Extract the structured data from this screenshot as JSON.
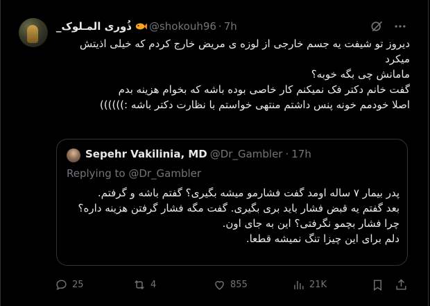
{
  "tweet": {
    "author": {
      "display_name": "ذُوری المـلوک_",
      "handle": "@shokouh96",
      "separator": "·",
      "time": "7h"
    },
    "text_lines": [
      "دیروز تو شیفت یه جسم خارجی از لوزه ی مریض خارج کردم که خیلی اذیتش میکرد",
      "مامانش چی بگه خوبه؟",
      "گفت خانم دکتر فک نمیکنم کار خاصی بوده باشه که بخوام هزینه بدم",
      "اصلا خودمم خونه پنس داشتم منتهی خواستم با نظارت دکتر باشه :))))))"
    ],
    "quote": {
      "display_name": "Sepehr Vakilinia, MD",
      "handle": "@Dr_Gambler",
      "separator": "·",
      "time": "17h",
      "replying_to": "Replying to @Dr_Gambler",
      "text_lines": [
        "پدر بیمار ۷ ساله اومد گفت فشارمو میشه بگیری؟ گفتم باشه و گرفتم.",
        "بعد گفتم یه قبض فشار باید بری بگیری. گفت مگه فشار گرفتن هزینه داره؟ چرا فشار بچمو نگرفتی؟ این به جای اون.",
        "دلم برای این چیزا تنگ نمیشه قطعا."
      ]
    },
    "actions": {
      "replies": "25",
      "reposts": "4",
      "likes": "855",
      "views": "21K"
    },
    "icons": {
      "author_emoji": "fish-icon",
      "grok": "grok-icon",
      "more": "more-icon",
      "reply": "reply-icon",
      "repost": "repost-icon",
      "like": "heart-icon",
      "views": "views-icon",
      "bookmark": "bookmark-icon",
      "share": "share-icon"
    },
    "colors": {
      "background": "#000000",
      "text": "#e7e9ea",
      "secondary": "#71767b",
      "border": "#2f3336"
    }
  }
}
